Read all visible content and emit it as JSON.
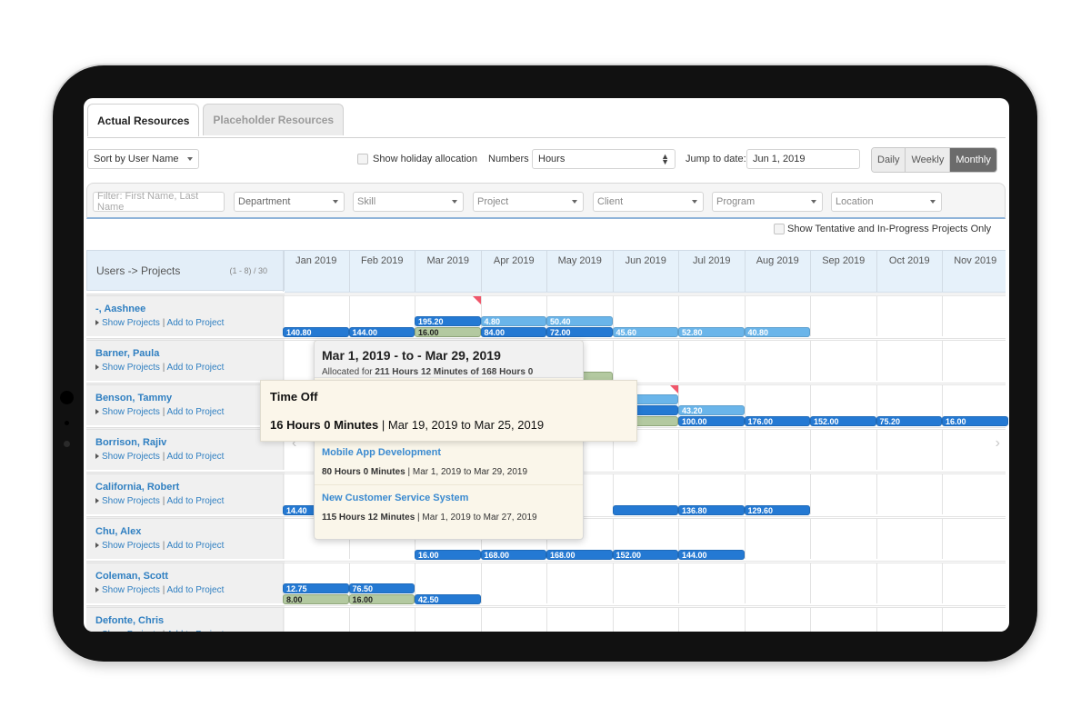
{
  "tabs": [
    {
      "label": "Actual Resources",
      "active": true
    },
    {
      "label": "Placeholder Resources",
      "active": false
    }
  ],
  "toolbar": {
    "sort_value": "Sort by User Name",
    "holiday_label": "Show holiday allocation",
    "holiday_checked": false,
    "numbers_label": "Numbers",
    "numbers_value": "Hours",
    "jump_label": "Jump to date:",
    "jump_value": "Jun 1, 2019",
    "views": [
      "Daily",
      "Weekly",
      "Monthly"
    ],
    "active_view": "Monthly"
  },
  "filters": {
    "name_placeholder": "Filter: First Name, Last Name",
    "department": "Department",
    "skill": "Skill",
    "project": "Project",
    "client": "Client",
    "program": "Program",
    "location": "Location",
    "tentative_label": "Show Tentative and In-Progress Projects Only",
    "tentative_checked": false
  },
  "grid": {
    "header_label": "Users -> Projects",
    "count_label": "(1 - 8) / 30",
    "months": [
      "Jan 2019",
      "Feb 2019",
      "Mar 2019",
      "Apr 2019",
      "May 2019",
      "Jun 2019",
      "Jul 2019",
      "Aug 2019",
      "Sep 2019",
      "Oct 2019",
      "Nov 2019"
    ],
    "link_show": "Show Projects",
    "link_sep": "|",
    "link_add": "Add to Project",
    "users": [
      {
        "name": "-, Aashnee",
        "bars": [
          {
            "month": 2,
            "span": 1,
            "lane": "top",
            "kind": "dark",
            "value": "195.20"
          },
          {
            "month": 3,
            "span": 1,
            "lane": "top",
            "kind": "light",
            "value": "4.80"
          },
          {
            "month": 4,
            "span": 1,
            "lane": "top",
            "kind": "light",
            "value": "50.40"
          },
          {
            "month": 0,
            "span": 1,
            "lane": "bottom",
            "kind": "dark",
            "value": "140.80"
          },
          {
            "month": 1,
            "span": 1,
            "lane": "bottom",
            "kind": "dark",
            "value": "144.00"
          },
          {
            "month": 2,
            "span": 1,
            "lane": "bottom",
            "kind": "green",
            "value": "16.00"
          },
          {
            "month": 3,
            "span": 1,
            "lane": "bottom",
            "kind": "dark",
            "value": "84.00"
          },
          {
            "month": 4,
            "span": 1,
            "lane": "bottom",
            "kind": "dark",
            "value": "72.00"
          },
          {
            "month": 5,
            "span": 1,
            "lane": "bottom",
            "kind": "light",
            "value": "45.60"
          },
          {
            "month": 6,
            "span": 1,
            "lane": "bottom",
            "kind": "light",
            "value": "52.80"
          },
          {
            "month": 7,
            "span": 1,
            "lane": "bottom",
            "kind": "light",
            "value": "40.80"
          }
        ],
        "flags": [
          2
        ]
      },
      {
        "name": "Barner, Paula",
        "bars": [
          {
            "month": 4,
            "span": 1,
            "lane": "mid",
            "kind": "green",
            "value": ""
          }
        ],
        "flags": []
      },
      {
        "name": "Benson, Tammy",
        "bars": [
          {
            "month": 5,
            "span": 1,
            "lane": "upper",
            "kind": "light",
            "value": ""
          },
          {
            "month": 6,
            "span": 1,
            "lane": "top",
            "kind": "light",
            "value": "43.20"
          },
          {
            "month": 5,
            "span": 1,
            "lane": "top",
            "kind": "dark",
            "value": ""
          },
          {
            "month": 5,
            "span": 1,
            "lane": "bottom",
            "kind": "green",
            "value": ""
          },
          {
            "month": 6,
            "span": 1,
            "lane": "bottom",
            "kind": "dark",
            "value": "100.00"
          },
          {
            "month": 7,
            "span": 1,
            "lane": "bottom",
            "kind": "dark",
            "value": "176.00"
          },
          {
            "month": 8,
            "span": 1,
            "lane": "bottom",
            "kind": "dark",
            "value": "152.00"
          },
          {
            "month": 9,
            "span": 1,
            "lane": "bottom",
            "kind": "dark",
            "value": "75.20"
          },
          {
            "month": 10,
            "span": 1,
            "lane": "bottom",
            "kind": "dark",
            "value": "16.00"
          }
        ],
        "flags": [
          5
        ]
      },
      {
        "name": "Borrison, Rajiv",
        "bars": [],
        "flags": []
      },
      {
        "name": "California, Robert",
        "bars": [
          {
            "month": 0,
            "span": 1,
            "lane": "bottom",
            "kind": "dark",
            "value": "14.40"
          },
          {
            "month": 5,
            "span": 1,
            "lane": "bottom",
            "kind": "dark",
            "value": ""
          },
          {
            "month": 6,
            "span": 1,
            "lane": "bottom",
            "kind": "dark",
            "value": "136.80"
          },
          {
            "month": 7,
            "span": 1,
            "lane": "bottom",
            "kind": "dark",
            "value": "129.60"
          }
        ],
        "flags": []
      },
      {
        "name": "Chu, Alex",
        "bars": [
          {
            "month": 2,
            "span": 1,
            "lane": "bottom",
            "kind": "dark",
            "value": "16.00"
          },
          {
            "month": 3,
            "span": 1,
            "lane": "bottom",
            "kind": "dark",
            "value": "168.00"
          },
          {
            "month": 4,
            "span": 1,
            "lane": "bottom",
            "kind": "dark",
            "value": "168.00"
          },
          {
            "month": 5,
            "span": 1,
            "lane": "bottom",
            "kind": "dark",
            "value": "152.00"
          },
          {
            "month": 6,
            "span": 1,
            "lane": "bottom",
            "kind": "dark",
            "value": "144.00"
          }
        ],
        "flags": []
      },
      {
        "name": "Coleman, Scott",
        "bars": [
          {
            "month": 0,
            "span": 1,
            "lane": "top",
            "kind": "dark",
            "value": "12.75"
          },
          {
            "month": 1,
            "span": 1,
            "lane": "top",
            "kind": "dark",
            "value": "76.50"
          },
          {
            "month": 0,
            "span": 1,
            "lane": "bottom",
            "kind": "green",
            "value": "8.00"
          },
          {
            "month": 1,
            "span": 1,
            "lane": "bottom",
            "kind": "green",
            "value": "16.00"
          },
          {
            "month": 2,
            "span": 1,
            "lane": "bottom",
            "kind": "dark",
            "value": "42.50"
          }
        ],
        "flags": []
      },
      {
        "name": "Defonte, Chris",
        "bars": [],
        "flags": []
      }
    ]
  },
  "popover_month": {
    "title": "Mar 1, 2019 - to - Mar 29, 2019",
    "allocated_prefix": "Allocated for",
    "allocated_value": "211 Hours 12 Minutes of 168 Hours 0",
    "projects": [
      {
        "name": "Mobile App Development",
        "hours": "80 Hours 0 Minutes",
        "dates": "Mar 1, 2019 to Mar 29, 2019"
      },
      {
        "name": "New Customer Service System",
        "hours": "115 Hours 12 Minutes",
        "dates": "Mar 1, 2019 to Mar 27, 2019"
      }
    ]
  },
  "popover_timeoff": {
    "title": "Time Off",
    "hours_num": "16",
    "hours_rest": "Hours 0 Minutes",
    "sep": "|",
    "dates": "Mar 19, 2019 to Mar 25, 2019"
  },
  "colors": {
    "bar_dark": "#2479d3",
    "bar_light": "#6ab5ea",
    "bar_timeoff": "#b3c9a0",
    "link": "#2f7fc1",
    "overallocated_flag": "#f0566a"
  }
}
